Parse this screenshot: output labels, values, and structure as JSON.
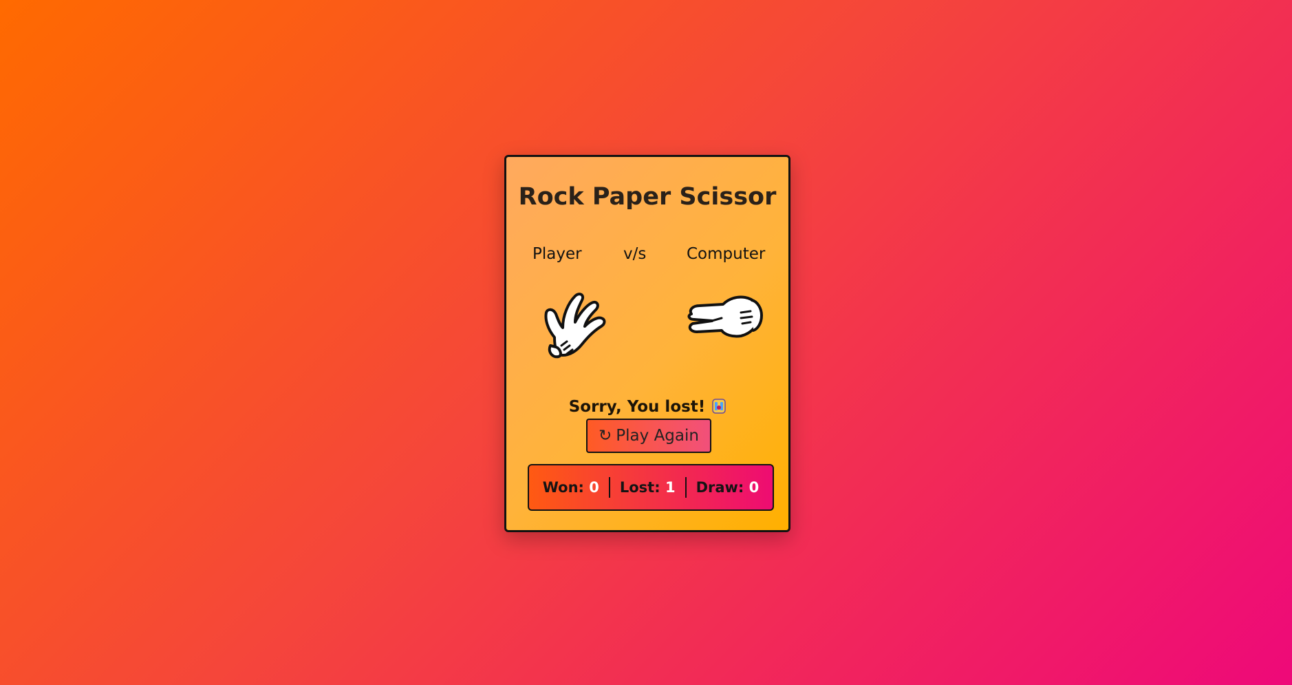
{
  "game": {
    "title": "Rock Paper Scissor",
    "player_label": "Player",
    "vs_label": "v/s",
    "computer_label": "Computer",
    "player_choice_icon": "paper-hand-icon",
    "computer_choice_icon": "scissors-hand-icon",
    "result_text": "Sorry, You lost!",
    "result_emoji": "crying-face-icon",
    "play_again_icon": "↻",
    "play_again_label": "Play Again"
  },
  "score": {
    "won_label": "Won:",
    "won_value": "0",
    "lost_label": "Lost:",
    "lost_value": "1",
    "draw_label": "Draw:",
    "draw_value": "0"
  },
  "colors": {
    "background_start": "#ff6a00",
    "background_end": "#ee0979",
    "card_start": "#ffa95e",
    "card_end": "#ffb000",
    "score_value": "#ffffff"
  }
}
